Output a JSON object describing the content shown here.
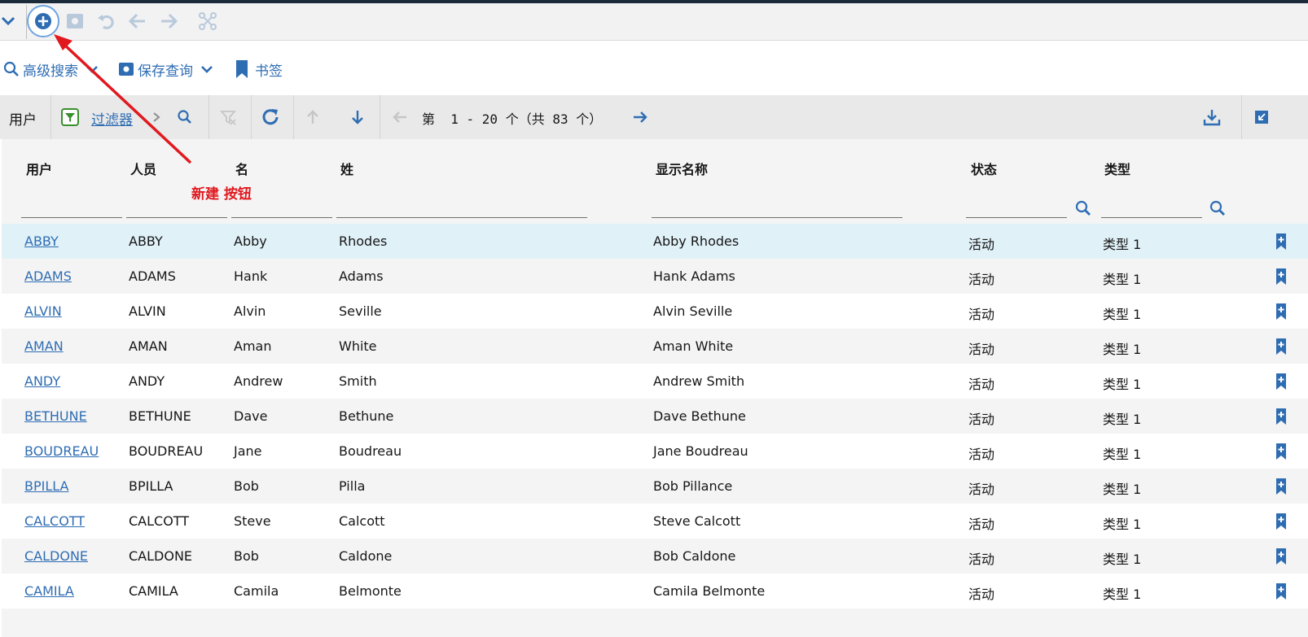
{
  "colors": {
    "accent": "#2f6db3",
    "annotation": "#e0191f",
    "selected_row": "#e0f1f8",
    "bookmark": "#2f6db3"
  },
  "toolbar": {
    "icons": [
      "chevron-down-icon",
      "new-icon",
      "save-record-icon",
      "undo-icon",
      "back-arrow-icon",
      "forward-arrow-icon",
      "workflow-icon"
    ]
  },
  "query_bar": {
    "advanced_search_label": "高级搜索",
    "saved_query_label": "保存查询",
    "bookmarks_label": "书签"
  },
  "list_bar": {
    "title": "用户",
    "filter_label": "过滤器",
    "pager_text": "第  1 - 20 个（共 83 个）"
  },
  "table": {
    "columns": [
      "用户",
      "人员",
      "名",
      "姓",
      "显示名称",
      "状态",
      "类型"
    ],
    "rows": [
      {
        "user": "ABBY",
        "person": "ABBY",
        "first": "Abby",
        "last": "Rhodes",
        "display": "Abby Rhodes",
        "status": "活动",
        "type": "类型 1"
      },
      {
        "user": "ADAMS",
        "person": "ADAMS",
        "first": "Hank",
        "last": "Adams",
        "display": "Hank Adams",
        "status": "活动",
        "type": "类型 1"
      },
      {
        "user": "ALVIN",
        "person": "ALVIN",
        "first": "Alvin",
        "last": "Seville",
        "display": "Alvin Seville",
        "status": "活动",
        "type": "类型 1"
      },
      {
        "user": "AMAN",
        "person": "AMAN",
        "first": "Aman",
        "last": "White",
        "display": "Aman White",
        "status": "活动",
        "type": "类型 1"
      },
      {
        "user": "ANDY",
        "person": "ANDY",
        "first": "Andrew",
        "last": "Smith",
        "display": "Andrew Smith",
        "status": "活动",
        "type": "类型 1"
      },
      {
        "user": "BETHUNE",
        "person": "BETHUNE",
        "first": "Dave",
        "last": "Bethune",
        "display": "Dave Bethune",
        "status": "活动",
        "type": "类型 1"
      },
      {
        "user": "BOUDREAU",
        "person": "BOUDREAU",
        "first": "Jane",
        "last": "Boudreau",
        "display": "Jane Boudreau",
        "status": "活动",
        "type": "类型 1"
      },
      {
        "user": "BPILLA",
        "person": "BPILLA",
        "first": "Bob",
        "last": "Pilla",
        "display": "Bob Pillance",
        "status": "活动",
        "type": "类型 1"
      },
      {
        "user": "CALCOTT",
        "person": "CALCOTT",
        "first": "Steve",
        "last": "Calcott",
        "display": "Steve Calcott",
        "status": "活动",
        "type": "类型 1"
      },
      {
        "user": "CALDONE",
        "person": "CALDONE",
        "first": "Bob",
        "last": "Caldone",
        "display": "Bob Caldone",
        "status": "活动",
        "type": "类型 1"
      },
      {
        "user": "CAMILA",
        "person": "CAMILA",
        "first": "Camila",
        "last": "Belmonte",
        "display": "Camila Belmonte",
        "status": "活动",
        "type": "类型 1"
      }
    ]
  },
  "annotation": {
    "label": "新建 按钮"
  }
}
